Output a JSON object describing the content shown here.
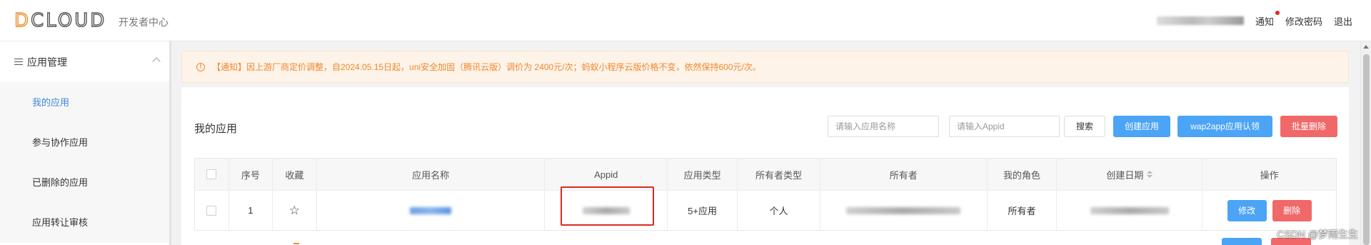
{
  "header": {
    "logo_text": "DCLOUD",
    "logo_first": "D",
    "logo_rest": "CLOUD",
    "subtitle": "开发者中心",
    "links": {
      "notify": "通知",
      "change_password": "修改密码",
      "logout": "退出"
    }
  },
  "sidebar": {
    "section_label": "应用管理",
    "items": [
      {
        "label": "我的应用",
        "active": true
      },
      {
        "label": "参与协作应用",
        "active": false
      },
      {
        "label": "已删除的应用",
        "active": false
      },
      {
        "label": "应用转让审核",
        "active": false
      }
    ]
  },
  "notice": {
    "text": "【通知】因上游厂商定价调整，自2024.05.15日起，uni安全加固（腾讯云版）调价为 2400元/次；蚂蚁小程序云版价格不变，依然保持600元/次。"
  },
  "panel": {
    "title": "我的应用",
    "search_name_placeholder": "请输入应用名称",
    "search_appid_placeholder": "请输入Appid",
    "search_button": "搜索",
    "create_button": "创建应用",
    "wap2app_button": "wap2app应用认领",
    "batch_delete_button": "批量删除"
  },
  "table": {
    "headers": [
      "序号",
      "收藏",
      "应用名称",
      "Appid",
      "应用类型",
      "所有者类型",
      "所有者",
      "我的角色",
      "创建日期",
      "操作"
    ],
    "rows": [
      {
        "index": "1",
        "app_type": "5+应用",
        "owner_type": "个人",
        "role": "所有者",
        "edit_label": "修改",
        "delete_label": "删除"
      }
    ]
  },
  "colors": {
    "accent_blue": "#4ba4f5",
    "danger_red": "#f06868",
    "notice_orange": "#f0882f",
    "highlight_red": "#e02a20"
  },
  "watermark": "CSDN @梦雨生生"
}
